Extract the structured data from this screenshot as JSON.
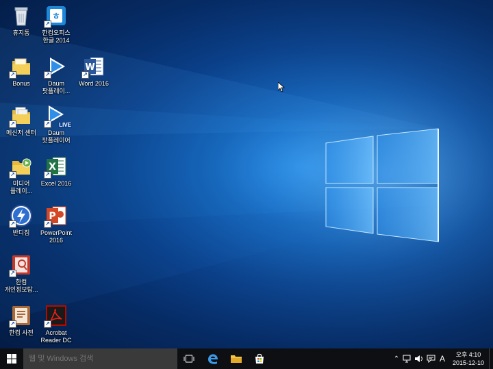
{
  "desktop": {
    "icons": [
      {
        "name": "recycle-bin",
        "label": "휴지통"
      },
      {
        "name": "hancom-office-hangul",
        "label": "한컴오피스\n한글 2014"
      },
      {
        "name": "bonus-folder",
        "label": "Bonus"
      },
      {
        "name": "daum-potplayer",
        "label": "Daum\n팟플레이..."
      },
      {
        "name": "word-2016",
        "label": "Word 2016"
      },
      {
        "name": "messenger-center",
        "label": "메신저 센터"
      },
      {
        "name": "daum-potplayer-live",
        "label": "Daum\n팟플레이어",
        "badge": "LIVE"
      },
      {
        "name": "media-player",
        "label": "미디어\n플레이..."
      },
      {
        "name": "excel-2016",
        "label": "Excel 2016"
      },
      {
        "name": "bandizip",
        "label": "반디집"
      },
      {
        "name": "powerpoint-2016",
        "label": "PowerPoint\n2016"
      },
      {
        "name": "hancom-privacy",
        "label": "한컴\n개인정보탐..."
      },
      {
        "name": "hancom-dictionary",
        "label": "한컴 사전"
      },
      {
        "name": "acrobat-reader-dc",
        "label": "Acrobat\nReader DC"
      }
    ]
  },
  "taskbar": {
    "search_placeholder": "웹 및 Windows 검색",
    "ime_indicator": "A",
    "clock": {
      "time": "오후 4:10",
      "date": "2015-12-10"
    }
  },
  "colors": {
    "taskbar": "#0e0f12",
    "search_box": "#3a3a3a",
    "desktop_blue": "#0f5bb0",
    "word_blue": "#2b579a",
    "excel_green": "#217346",
    "powerpoint_orange": "#d24726"
  }
}
